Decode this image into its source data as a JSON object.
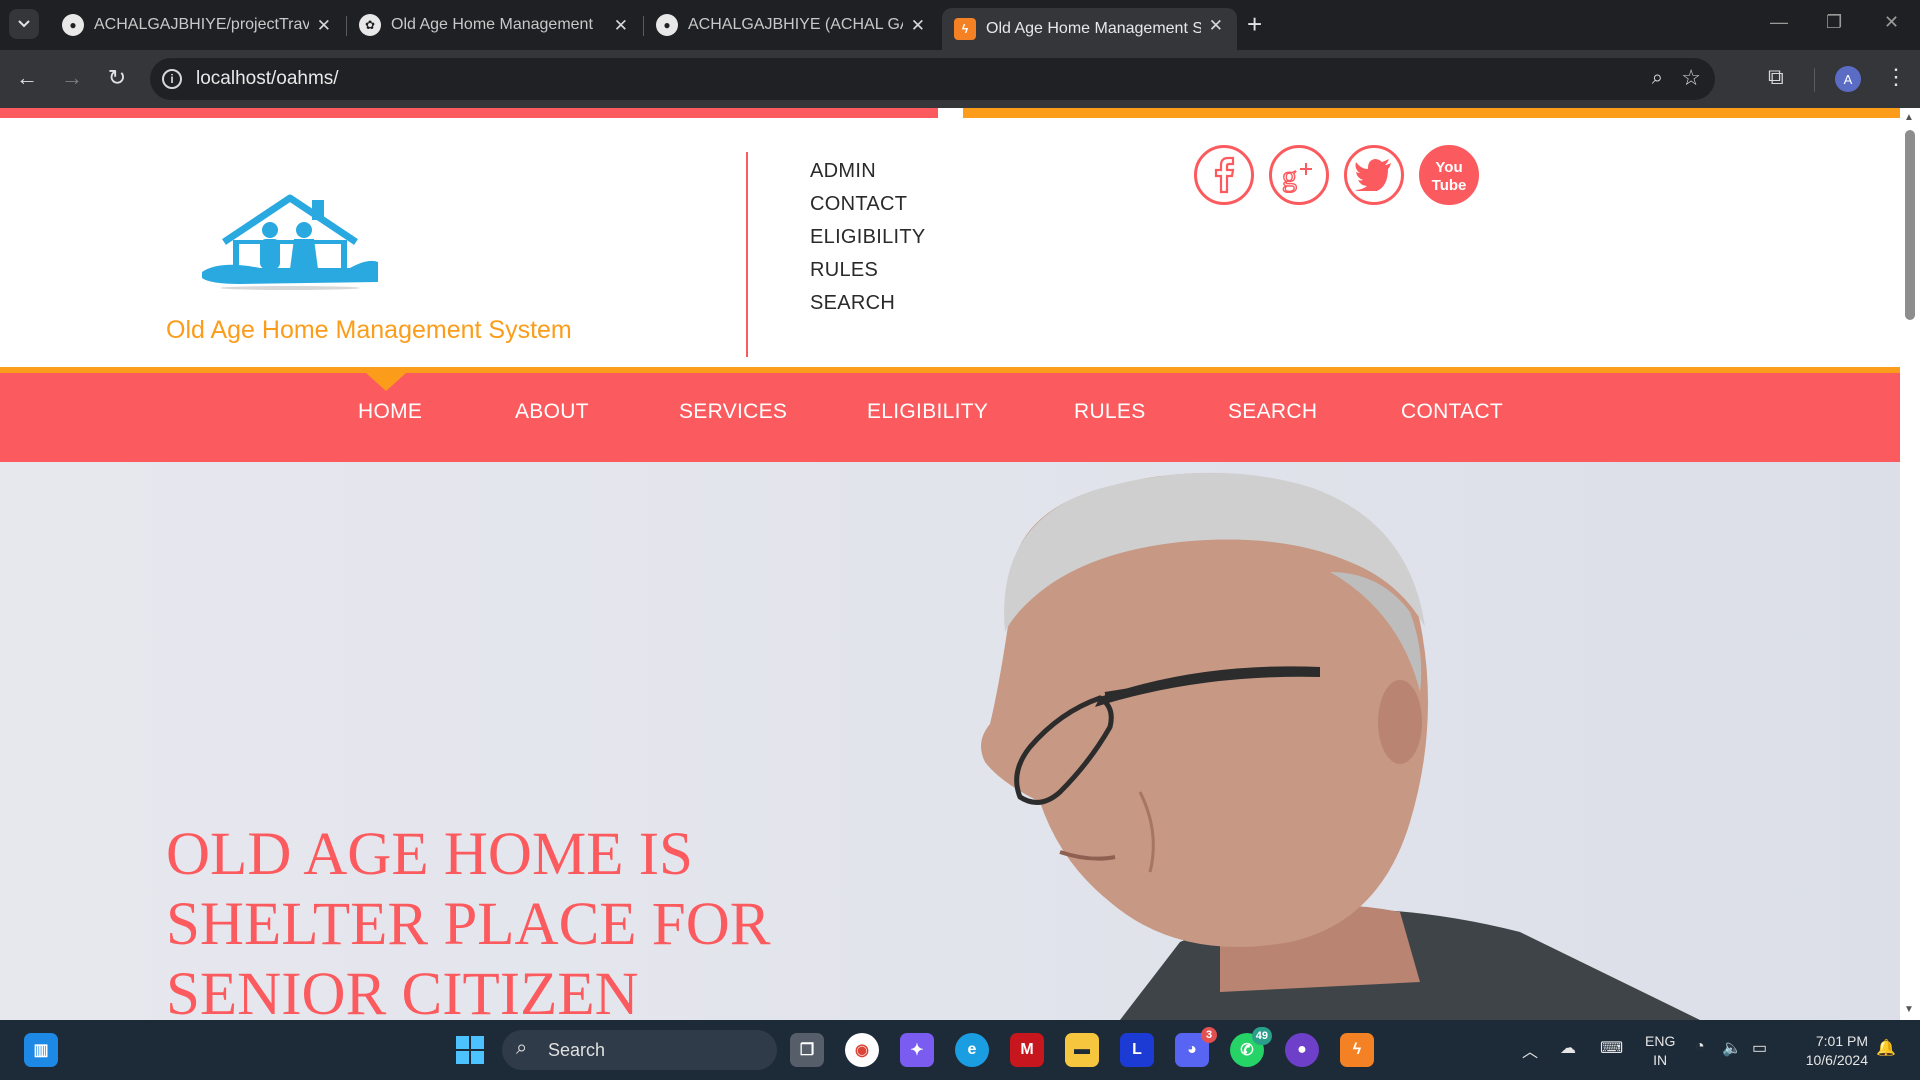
{
  "browser": {
    "tabs": [
      {
        "title": "ACHALGAJBHIYE/projectTravelL",
        "favicon": "github-icon"
      },
      {
        "title": "Old Age Home Management",
        "favicon": "openai-icon"
      },
      {
        "title": "ACHALGAJBHIYE (ACHAL GAJBI",
        "favicon": "github-icon"
      },
      {
        "title": "Old Age Home Management Sy",
        "favicon": "xampp-icon",
        "active": true
      }
    ],
    "url": "localhost/oahms/",
    "profile_initial": "A"
  },
  "site": {
    "title": "Old Age Home Management System",
    "quick_links": [
      "ADMIN",
      "CONTACT",
      "ELIGIBILITY",
      "RULES",
      "SEARCH"
    ],
    "social": [
      "facebook",
      "google-plus",
      "twitter",
      "youtube"
    ],
    "youtube_text_top": "You",
    "youtube_text_bottom": "Tube",
    "nav": [
      "HOME",
      "ABOUT",
      "SERVICES",
      "ELIGIBILITY",
      "RULES",
      "SEARCH",
      "CONTACT"
    ],
    "active_nav": "HOME",
    "hero_heading": "OLD AGE HOME IS SHELTER PLACE FOR SENIOR CITIZEN"
  },
  "colors": {
    "brand_red": "#fb5b5e",
    "brand_orange": "#fb9d1a",
    "logo_blue": "#2aa9e0"
  },
  "taskbar": {
    "search_label": "Search",
    "discord_badge": "3",
    "whatsapp_badge": "49",
    "lang_top": "ENG",
    "lang_bottom": "IN",
    "time": "7:01 PM",
    "date": "10/6/2024"
  }
}
